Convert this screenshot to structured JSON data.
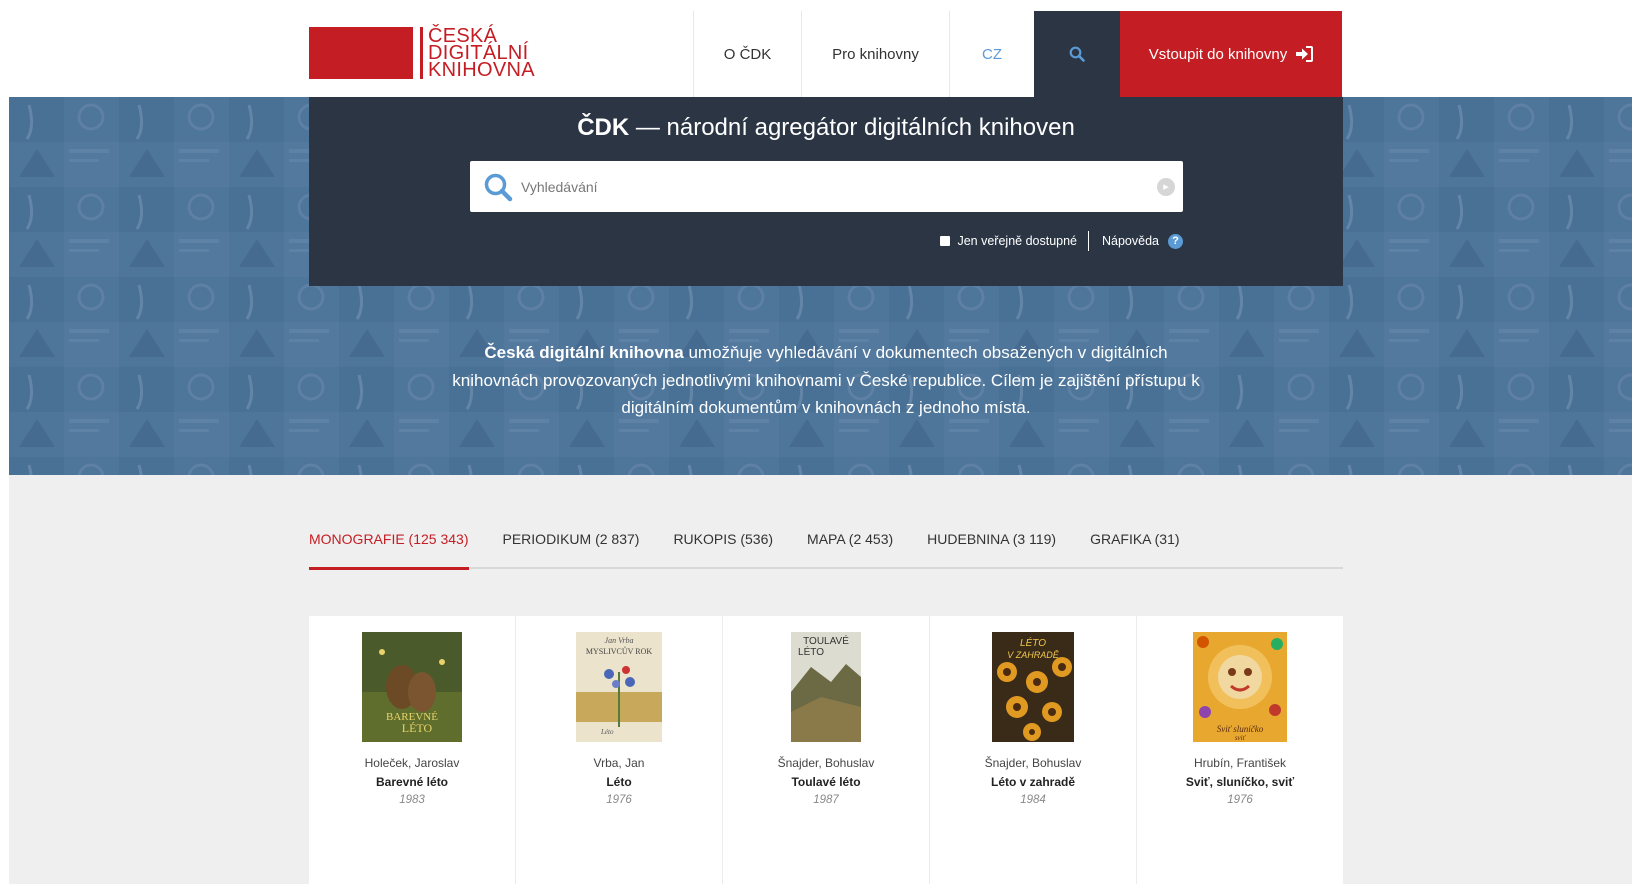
{
  "logo": {
    "line1": "ČESKÁ",
    "line2": "DIGITÁLNÍ",
    "line3": "KNIHOVNA",
    "color": "#c41e24"
  },
  "nav": {
    "about": "O ČDK",
    "libraries": "Pro knihovny",
    "language": "CZ",
    "search_icon": "search-icon",
    "login": "Vstoupit do knihovny",
    "login_icon": "sign-in-icon"
  },
  "hero": {
    "title_bold": "ČDK",
    "title_rest": " — národní agregátor digitálních knihoven",
    "search_placeholder": "Vyhledávání",
    "public_only": "Jen veřejně dostupné",
    "help": "Nápověda",
    "help_icon": "?",
    "desc_bold": "Česká digitální knihovna",
    "desc_rest": " umožňuje vyhledávání v dokumentech obsažených v digitálních knihovnách provozovaných jednotlivými knihovnami v České republice. Cílem je zajištění přístupu k digitálním dokumentům v knihovnách z jednoho místa."
  },
  "tabs": [
    {
      "label": "MONOGRAFIE (125 343)",
      "active": true
    },
    {
      "label": "PERIODIKUM (2 837)",
      "active": false
    },
    {
      "label": "RUKOPIS (536)",
      "active": false
    },
    {
      "label": "MAPA (2 453)",
      "active": false
    },
    {
      "label": "HUDEBNINA (3 119)",
      "active": false
    },
    {
      "label": "GRAFIKA (31)",
      "active": false
    }
  ],
  "books": [
    {
      "author": "Holeček, Jaroslav",
      "title": "Barevné léto",
      "year": "1983",
      "cover_text": "BAREVNÉ LÉTO"
    },
    {
      "author": "Vrba, Jan",
      "title": "Léto",
      "year": "1976",
      "cover_text": "Jan Vrba MYSLIVCŮV ROK"
    },
    {
      "author": "Šnajder, Bohuslav",
      "title": "Toulavé léto",
      "year": "1987",
      "cover_text": "TOULAVÉ LÉTO"
    },
    {
      "author": "Šnajder, Bohuslav",
      "title": "Léto v zahradě",
      "year": "1984",
      "cover_text": "LÉTO V ZAHRADĚ"
    },
    {
      "author": "Hrubín, František",
      "title": "Sviť, sluníčko, sviť",
      "year": "1976",
      "cover_text": "Sviť sluníčko sviť"
    }
  ],
  "colors": {
    "brand_red": "#c41e24",
    "dark_panel": "#2b3544",
    "accent_blue": "#5b9bd5"
  }
}
